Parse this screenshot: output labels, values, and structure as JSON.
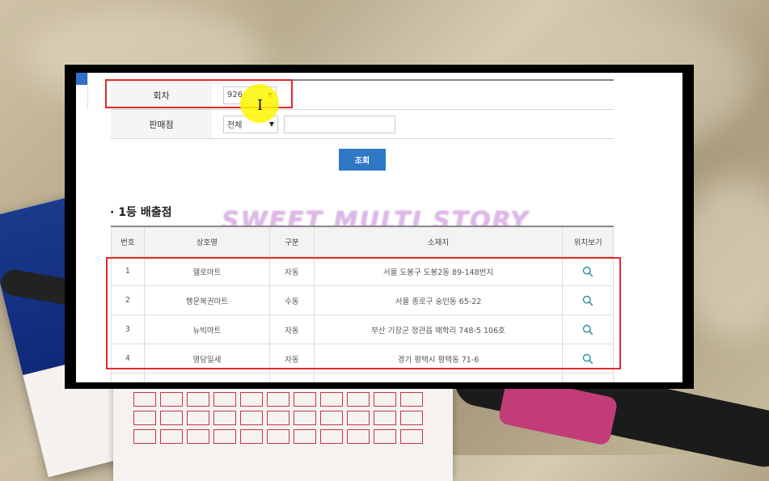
{
  "form": {
    "round_label": "회차",
    "round_value": "926",
    "store_label": "판매점",
    "store_value": "전체",
    "store_search_placeholder": ""
  },
  "search_button": "조회",
  "section": {
    "bullet": "·",
    "title": "1등 배출점"
  },
  "watermark": "SWEET MULTI STORY",
  "table": {
    "headers": [
      "번호",
      "상호명",
      "구분",
      "소재지",
      "위치보기"
    ],
    "rows": [
      {
        "no": "1",
        "name": "헬로마트",
        "type": "자동",
        "address": "서울 도봉구 도봉2동 89-148번지"
      },
      {
        "no": "2",
        "name": "행운복권마트",
        "type": "수동",
        "address": "서울 종로구 숭인동 65-22"
      },
      {
        "no": "3",
        "name": "뉴빅마트",
        "type": "자동",
        "address": "부산 기장군 정관읍 매학리 748-5 106호"
      },
      {
        "no": "4",
        "name": "명당일세",
        "type": "자동",
        "address": "경기 평택시 평택동 71-6"
      }
    ]
  },
  "colors": {
    "accent_button": "#2f78c6",
    "highlight_box": "#e22b2b",
    "cursor_highlight": "#fff500",
    "search_icon": "#2a8fa0"
  },
  "icons": {
    "view_location": "search-icon",
    "dropdown": "chevron-down-icon"
  }
}
